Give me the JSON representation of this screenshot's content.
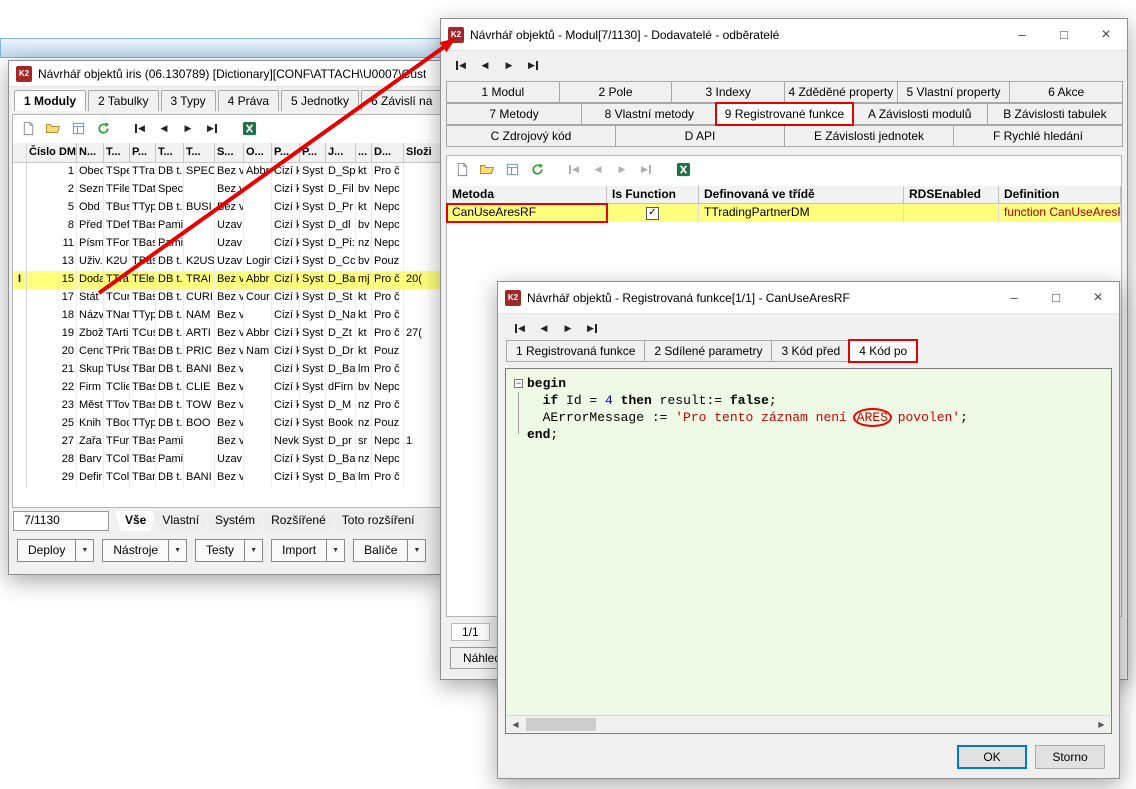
{
  "icons": {
    "minimize": "–",
    "maximize": "□",
    "close": "×",
    "check": "✓",
    "caret": "▼",
    "prev": "◀",
    "next": "▶",
    "row_cursor": "I",
    "fold_minus": "−",
    "logo": "K2"
  },
  "background_window": {
    "title": "Návrhář objektů iris (06.130789) [Dictionary][CONF\\ATTACH\\U0007\\Cust",
    "tabs": [
      {
        "label": "1 Moduly",
        "active": true
      },
      {
        "label": "2 Tabulky"
      },
      {
        "label": "3 Typy"
      },
      {
        "label": "4 Práva"
      },
      {
        "label": "5 Jednotky"
      },
      {
        "label": "6 Závislí na"
      }
    ],
    "table": {
      "columns": [
        "Číslo DM",
        "N...",
        "T...",
        "P...",
        "T...",
        "T...",
        "S...",
        "O...",
        "P...",
        "P...",
        "J...",
        "...",
        "D...",
        "Složi"
      ],
      "rows": [
        {
          "cells": [
            "1",
            "Obec",
            "TSpe",
            "TTra",
            "DB t.",
            "SPEC",
            "Bez v",
            "Abbr",
            "Cizí k",
            "Syst",
            "D_Sp",
            "kt",
            "Pro č",
            ""
          ]
        },
        {
          "cells": [
            "2",
            "Sezn",
            "TFile",
            "TDat",
            "Spec",
            "",
            "Bez v",
            "",
            "Cizí k",
            "Syst",
            "D_Fil",
            "bv",
            "Nepc",
            ""
          ]
        },
        {
          "cells": [
            "5",
            "Obd",
            "TBus",
            "TTyp",
            "DB t.",
            "BUSI",
            "Bez v",
            "",
            "Cizí k",
            "Syst",
            "D_Pr",
            "kt",
            "Nepc",
            ""
          ]
        },
        {
          "cells": [
            "8",
            "Před",
            "TDef",
            "TBas",
            "Pami",
            "",
            "Uzav",
            "",
            "Cizí k",
            "Syst",
            "D_dl",
            "bv",
            "Nepc",
            ""
          ]
        },
        {
          "cells": [
            "11",
            "Písm",
            "TFor",
            "TBas",
            "Pami",
            "",
            "Uzav",
            "",
            "Cizí k",
            "Syst",
            "D_Pi:",
            "nz",
            "Nepc",
            ""
          ]
        },
        {
          "cells": [
            "13",
            "Uživ.",
            "K2U",
            "TBas",
            "DB t.",
            "K2US",
            "Uzav",
            "Logir",
            "Cizí k",
            "Syst",
            "D_Cc",
            "bv",
            "Pouz",
            ""
          ]
        },
        {
          "cells": [
            "15",
            "Doda",
            "TTra",
            "TEle",
            "DB t.",
            "TRAI",
            "Bez v",
            "Abbr",
            "Cizí k",
            "Syst",
            "D_Ba",
            "mj",
            "Pro č",
            "20("
          ],
          "selected": true
        },
        {
          "cells": [
            "17",
            "Stát",
            "TCur",
            "TBas",
            "DB t.",
            "CURI",
            "Bez v",
            "Cour",
            "Cizí k",
            "Syst",
            "D_St",
            "kt",
            "Pro č",
            ""
          ]
        },
        {
          "cells": [
            "18",
            "Názv",
            "TNar",
            "TTyp",
            "DB t.",
            "NAM",
            "Bez v",
            "",
            "Cizí k",
            "Syst",
            "D_Na",
            "kt",
            "Pro č",
            ""
          ]
        },
        {
          "cells": [
            "19",
            "Zbož",
            "TArti",
            "TCus",
            "DB t.",
            "ARTI",
            "Bez v",
            "Abbr",
            "Cizí k",
            "Syst",
            "D_Zt",
            "kt",
            "Pro č",
            "27("
          ]
        },
        {
          "cells": [
            "20",
            "Cenc",
            "TPric",
            "TBas",
            "DB t.",
            "PRIC",
            "Bez v",
            "Nam",
            "Cizí k",
            "Syst",
            "D_Dr",
            "kt",
            "Pouz",
            ""
          ]
        },
        {
          "cells": [
            "21",
            "Skup",
            "TUse",
            "TBar",
            "DB t.",
            "BANI",
            "Bez v",
            "",
            "Cizí k",
            "Syst",
            "D_Ba",
            "lm",
            "Pro č",
            ""
          ]
        },
        {
          "cells": [
            "22",
            "Firm",
            "TClie",
            "TBas",
            "DB t.",
            "CLIE",
            "Bez v",
            "",
            "Cizí k",
            "Syst",
            "dFirn",
            "bv",
            "Nepc",
            ""
          ]
        },
        {
          "cells": [
            "23",
            "Měst",
            "TTov",
            "TBas",
            "DB t.",
            "TOW",
            "Bez v",
            "",
            "Cizí k",
            "Syst",
            "D_M",
            "nz",
            "Pro č",
            ""
          ]
        },
        {
          "cells": [
            "25",
            "Knih",
            "TBoc",
            "TTyp",
            "DB t.",
            "BOO",
            "Bez v",
            "",
            "Cizí k",
            "Syst",
            "Book",
            "nz",
            "Pouz",
            ""
          ]
        },
        {
          "cells": [
            "27",
            "Zařa",
            "TFur",
            "TBas",
            "Pami",
            "",
            "Bez v",
            "",
            "Nevk",
            "Syst",
            "D_pr",
            "sr",
            "Nepc",
            "1"
          ]
        },
        {
          "cells": [
            "28",
            "Barv",
            "TCol",
            "TBas",
            "Pami",
            "",
            "Uzav",
            "",
            "Cizí k",
            "Syst",
            "D_Ba",
            "nz",
            "Nepc",
            ""
          ]
        },
        {
          "cells": [
            "29",
            "Defir",
            "TCol",
            "TBar",
            "DB t.",
            "BANI",
            "Bez v",
            "",
            "Cizí k",
            "Syst",
            "D_Ba",
            "lm",
            "Pro č",
            ""
          ]
        }
      ]
    },
    "record_counter": "7/1130",
    "filter_tabs": [
      {
        "label": "Vše",
        "active": true
      },
      {
        "label": "Vlastní"
      },
      {
        "label": "Systém"
      },
      {
        "label": "Rozšířené"
      },
      {
        "label": "Toto rozšíření"
      }
    ],
    "action_buttons": [
      "Deploy",
      "Nástroje",
      "Testy",
      "Import",
      "Balíče"
    ]
  },
  "module_window": {
    "title": "Návrhář objektů - Modul[7/1130] - Dodavatelé - odběratelé",
    "tab_rows": [
      [
        {
          "label": "1 Modul"
        },
        {
          "label": "2 Pole"
        },
        {
          "label": "3 Indexy"
        },
        {
          "label": "4 Zděděné property"
        },
        {
          "label": "5 Vlastní property"
        },
        {
          "label": "6 Akce"
        }
      ],
      [
        {
          "label": "7 Metody"
        },
        {
          "label": "8 Vlastní metody"
        },
        {
          "label": "9 Registrované funkce",
          "active": true,
          "annotated": true
        },
        {
          "label": "A Závislosti modulů"
        },
        {
          "label": "B Závislosti tabulek"
        }
      ],
      [
        {
          "label": "C Zdrojový kód"
        },
        {
          "label": "D API"
        },
        {
          "label": "E Závislosti jednotek"
        },
        {
          "label": "F Rychlé hledání"
        }
      ]
    ],
    "grid": {
      "columns": [
        "Metoda",
        "Is Function",
        "Definovaná ve třídě",
        "RDSEnabled",
        "Definition"
      ],
      "row": {
        "metoda": "CanUseAresRF",
        "definovana": "TTradingPartnerDM",
        "rds": "",
        "definition": "function CanUseAresRF(out AErr"
      }
    },
    "record_counter": "1/1",
    "nahled_button": "Náhled"
  },
  "function_window": {
    "title": "Návrhář objektů - Registrovaná funkce[1/1] - CanUseAresRF",
    "tabs": [
      {
        "label": "1 Registrovaná funkce"
      },
      {
        "label": "2 Sdílené parametry"
      },
      {
        "label": "3 Kód před"
      },
      {
        "label": "4 Kód po",
        "active": true,
        "annotated": true
      }
    ],
    "code": {
      "lines": [
        {
          "gutter": "minus",
          "tokens": [
            {
              "t": "begin",
              "c": "kw"
            }
          ]
        },
        {
          "gutter": "line",
          "tokens": [
            {
              "t": "  ",
              "c": "plain"
            },
            {
              "t": "if",
              "c": "kw"
            },
            {
              "t": " Id = ",
              "c": "plain"
            },
            {
              "t": "4",
              "c": "num"
            },
            {
              "t": " ",
              "c": "plain"
            },
            {
              "t": "then",
              "c": "kw"
            },
            {
              "t": " result:= ",
              "c": "plain"
            },
            {
              "t": "false",
              "c": "kw"
            },
            {
              "t": ";",
              "c": "plain"
            }
          ]
        },
        {
          "gutter": "line",
          "tokens": [
            {
              "t": "  AErrorMessage := ",
              "c": "plain"
            },
            {
              "t": "'Pro tento záznam není ",
              "c": "str"
            },
            {
              "t": "ARES",
              "c": "str-mark"
            },
            {
              "t": " povolen'",
              "c": "str"
            },
            {
              "t": ";",
              "c": "plain"
            }
          ]
        },
        {
          "gutter": "end",
          "tokens": [
            {
              "t": "end",
              "c": "kw"
            },
            {
              "t": ";",
              "c": "plain"
            }
          ]
        }
      ]
    },
    "ok_button": "OK",
    "storno_button": "Storno"
  }
}
